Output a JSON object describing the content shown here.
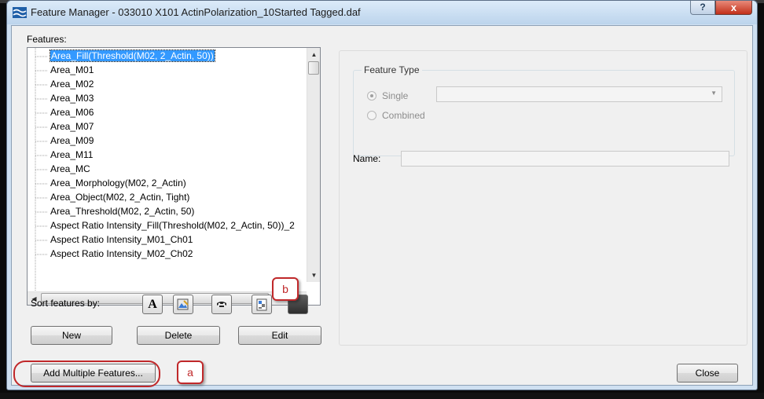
{
  "window": {
    "title": "Feature Manager - 033010 X101 ActinPolarization_10Started Tagged.daf",
    "help_label": "?",
    "close_label": "x"
  },
  "features": {
    "label": "Features:",
    "items": [
      "Area_Fill(Threshold(M02, 2_Actin, 50))",
      "Area_M01",
      "Area_M02",
      "Area_M03",
      "Area_M06",
      "Area_M07",
      "Area_M09",
      "Area_M11",
      "Area_MC",
      "Area_Morphology(M02, 2_Actin)",
      "Area_Object(M02, 2_Actin, Tight)",
      "Area_Threshold(M02, 2_Actin, 50)",
      "Aspect Ratio Intensity_Fill(Threshold(M02, 2_Actin, 50))_2",
      "Aspect Ratio Intensity_M01_Ch01",
      "Aspect Ratio Intensity_M02_Ch02"
    ],
    "selected_index": 0,
    "hscroll_grip": "III"
  },
  "sort": {
    "label": "Sort features by:",
    "buttons": [
      "A",
      "",
      "",
      "",
      ""
    ]
  },
  "actions": {
    "new_label": "New",
    "delete_label": "Delete",
    "edit_label": "Edit",
    "add_multiple_label": "Add Multiple Features...",
    "close_label": "Close"
  },
  "feature_type": {
    "group_title": "Feature Type",
    "single_label": "Single",
    "combined_label": "Combined",
    "single_checked": true,
    "combo_value": ""
  },
  "name": {
    "label": "Name:",
    "value": ""
  },
  "callouts": {
    "a": "a",
    "b": "b"
  },
  "colors": {
    "selection": "#3399ff",
    "callout": "#c0282a",
    "dialog_bg": "#f0f0f0"
  }
}
